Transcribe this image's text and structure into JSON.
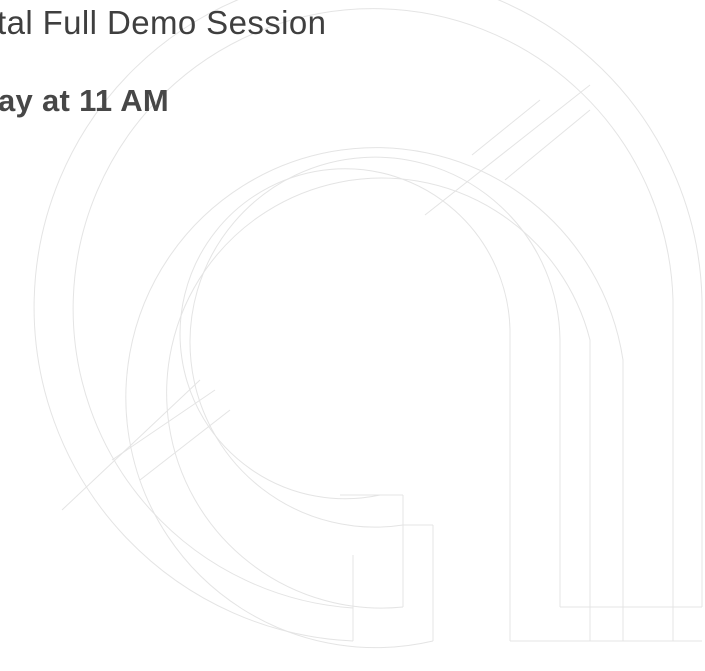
{
  "session": {
    "title": "tal Full Demo Session",
    "time": "ay at 11 AM"
  },
  "background": {
    "logo_icon": "outline-logo-mark",
    "stroke_color": "#e4e4e4"
  },
  "colors": {
    "title_text": "#3f3f3f",
    "time_text": "#474747",
    "background": "#ffffff"
  }
}
